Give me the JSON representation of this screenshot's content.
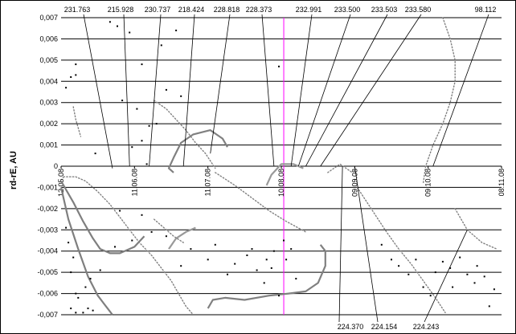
{
  "chart_data": {
    "type": "scatter",
    "title": "",
    "ylabel": "rd-rE, AU",
    "xlabel": "",
    "ylim": [
      -0.007,
      0.007
    ],
    "yticks": [
      "-0,007",
      "-0,006",
      "-0,005",
      "-0,004",
      "-0,003",
      "-0,002",
      "-0,001",
      "0",
      "0,001",
      "0,002",
      "0,003",
      "0,004",
      "0,005",
      "0,006",
      "0,007"
    ],
    "xrange": [
      "12.05.08",
      "08.11.08"
    ],
    "xticks": [
      {
        "date": "12.05.08",
        "label": "12.05.08"
      },
      {
        "date": "11.06.08",
        "label": "11.06.08"
      },
      {
        "date": "11.07.08",
        "label": "11.07.08"
      },
      {
        "date": "10.08.08",
        "label": "10.08.08"
      },
      {
        "date": "09.09.08",
        "label": "09.09.08"
      },
      {
        "date": "09.10.08",
        "label": "09.10.08"
      },
      {
        "date": "08.11.08",
        "label": "08.11.08"
      }
    ],
    "grid": "horizontal",
    "marker_date": "11.08.08",
    "marker_color": "#ff00ff",
    "annotations_top": [
      {
        "label": "231.763",
        "date": "02.06.08",
        "y": -0.0001
      },
      {
        "label": "215.928",
        "date": "09.06.08",
        "y": 0.0
      },
      {
        "label": "230.737",
        "date": "17.06.08",
        "y": 0.0
      },
      {
        "label": "218.424",
        "date": "01.07.08",
        "y": 0.0
      },
      {
        "label": "228.818",
        "date": "12.07.08",
        "y": 0.0006
      },
      {
        "label": "228.373",
        "date": "07.08.08",
        "y": 0.0
      },
      {
        "label": "232.991",
        "date": "14.08.08",
        "y": 0.0
      },
      {
        "label": "233.500",
        "date": "17.08.08",
        "y": 0.0
      },
      {
        "label": "233.503",
        "date": "20.08.08",
        "y": 0.0
      },
      {
        "label": "233.580",
        "date": "26.08.08",
        "y": 0.0
      },
      {
        "label": "98.112",
        "date": "11.10.08",
        "y": 0.0
      }
    ],
    "annotations_bottom": [
      {
        "label": "224.370",
        "date": "04.09.08",
        "y": 0.0
      },
      {
        "label": "224.154",
        "date": "09.09.08",
        "y": 0.0
      },
      {
        "label": "224.243",
        "date": "25.10.08",
        "y": -0.003
      }
    ],
    "series": [
      {
        "style": "curve",
        "color": "#7f7f7f",
        "points": [
          [
            "12.05.08",
            -0.0007
          ],
          [
            "17.05.08",
            -0.0017
          ],
          [
            "21.05.08",
            -0.0026
          ],
          [
            "25.05.08",
            -0.0034
          ],
          [
            "28.05.08",
            -0.0039
          ],
          [
            "01.06.08",
            -0.0041
          ],
          [
            "05.06.08",
            -0.0041
          ],
          [
            "11.06.08",
            -0.0038
          ],
          [
            "15.06.08",
            -0.0033
          ]
        ]
      },
      {
        "style": "curve",
        "color": "#7f7f7f",
        "points": [
          [
            "12.05.08",
            -0.001
          ],
          [
            "15.05.08",
            -0.0025
          ],
          [
            "19.05.08",
            -0.0039
          ],
          [
            "23.05.08",
            -0.0052
          ],
          [
            "27.05.08",
            -0.0061
          ],
          [
            "31.05.08",
            -0.0067
          ],
          [
            "02.06.08",
            -0.007
          ]
        ]
      },
      {
        "style": "curve",
        "color": "#808080",
        "points": [
          [
            "19.07.08",
            0.0009
          ],
          [
            "17.07.08",
            0.0013
          ],
          [
            "12.07.08",
            0.0017
          ],
          [
            "05.07.08",
            0.0015
          ],
          [
            "30.06.08",
            0.0011
          ],
          [
            "27.06.08",
            0.0004
          ],
          [
            "25.06.08",
            -0.0001
          ],
          [
            "27.06.08",
            -0.0003
          ]
        ]
      },
      {
        "style": "curve",
        "color": "#808080",
        "points": [
          [
            "11.07.08",
            -0.0067
          ],
          [
            "13.07.08",
            -0.0063
          ],
          [
            "18.07.08",
            -0.0062
          ],
          [
            "26.07.08",
            -0.0063
          ],
          [
            "05.08.08",
            -0.0061
          ],
          [
            "13.08.08",
            -0.006
          ],
          [
            "20.08.08",
            -0.0059
          ],
          [
            "25.08.08",
            -0.0055
          ],
          [
            "28.08.08",
            -0.0047
          ],
          [
            "28.08.08",
            -0.004
          ],
          [
            "26.08.08",
            -0.0037
          ]
        ]
      },
      {
        "style": "curve",
        "color": "#999999",
        "points": [
          [
            "04.08.08",
            -0.0009
          ],
          [
            "06.08.08",
            -0.0004
          ],
          [
            "10.08.08",
            0.0001
          ],
          [
            "15.08.08",
            0.0001
          ],
          [
            "19.08.08",
            -0.0001
          ]
        ]
      },
      {
        "style": "curve",
        "color": "#999999",
        "points": [
          [
            "25.06.08",
            -0.0039
          ],
          [
            "28.06.08",
            -0.0034
          ],
          [
            "02.07.08",
            -0.0031
          ],
          [
            "06.07.08",
            -0.0029
          ]
        ]
      },
      {
        "style": "dotted",
        "color": "#808080",
        "points": [
          [
            "13.05.08",
            -0.0005
          ],
          [
            "18.05.08",
            -0.0005
          ],
          [
            "22.05.08",
            -0.0007
          ],
          [
            "27.05.08",
            -0.0012
          ],
          [
            "01.06.08",
            -0.0018
          ],
          [
            "05.06.08",
            -0.0024
          ],
          [
            "09.06.08",
            -0.003
          ],
          [
            "13.06.08",
            -0.0036
          ],
          [
            "18.06.08",
            -0.0042
          ],
          [
            "22.06.08",
            -0.0048
          ],
          [
            "26.06.08",
            -0.0054
          ],
          [
            "29.06.08",
            -0.006
          ],
          [
            "02.07.08",
            -0.0066
          ],
          [
            "05.07.08",
            -0.007
          ]
        ]
      },
      {
        "style": "dotted",
        "color": "#808080",
        "points": [
          [
            "19.06.08",
            0.0031
          ],
          [
            "24.06.08",
            0.0027
          ],
          [
            "28.06.08",
            0.0022
          ],
          [
            "02.07.08",
            0.0017
          ],
          [
            "06.07.08",
            0.0011
          ],
          [
            "10.07.08",
            0.0006
          ],
          [
            "14.07.08",
            -0.0001
          ]
        ]
      },
      {
        "style": "dotted",
        "color": "#808080",
        "points": [
          [
            "15.10.08",
            0.007
          ],
          [
            "18.10.08",
            0.006
          ],
          [
            "20.10.08",
            0.005
          ],
          [
            "20.10.08",
            0.004
          ],
          [
            "18.10.08",
            0.003
          ],
          [
            "15.10.08",
            0.002
          ],
          [
            "11.10.08",
            0.001
          ],
          [
            "08.10.08",
            0.0
          ],
          [
            "07.10.08",
            -0.0008
          ]
        ]
      },
      {
        "style": "dotted",
        "color": "#808080",
        "points": [
          [
            "14.07.08",
            -0.0003
          ],
          [
            "22.07.08",
            -0.0009
          ],
          [
            "29.07.08",
            -0.0015
          ],
          [
            "05.08.08",
            -0.0021
          ],
          [
            "12.08.08",
            -0.0026
          ],
          [
            "20.08.08",
            -0.0031
          ]
        ]
      },
      {
        "style": "dotted",
        "color": "#808080",
        "points": [
          [
            "10.09.08",
            -0.001
          ],
          [
            "14.09.08",
            -0.0017
          ],
          [
            "18.09.08",
            -0.0024
          ],
          [
            "22.09.08",
            -0.0031
          ],
          [
            "27.09.08",
            -0.0039
          ],
          [
            "02.10.08",
            -0.0046
          ],
          [
            "07.10.08",
            -0.0054
          ],
          [
            "12.10.08",
            -0.0062
          ],
          [
            "16.10.08",
            -0.0069
          ]
        ]
      },
      {
        "style": "dotted",
        "color": "#808080",
        "points": [
          [
            "20.10.08",
            -0.002
          ],
          [
            "25.10.08",
            -0.003
          ],
          [
            "31.10.08",
            -0.0036
          ],
          [
            "06.11.08",
            -0.0039
          ]
        ]
      },
      {
        "style": "dotted",
        "color": "#808080",
        "points": [
          [
            "29.08.08",
            -0.0003
          ],
          [
            "03.09.08",
            0.0001
          ],
          [
            "08.09.08",
            -0.0003
          ]
        ]
      },
      {
        "style": "dotted",
        "color": "#808080",
        "points": [
          [
            "17.05.08",
            0.0028
          ],
          [
            "18.05.08",
            0.0022
          ],
          [
            "20.05.08",
            0.0014
          ]
        ]
      },
      {
        "style": "dotted",
        "color": "#808080",
        "points": [
          [
            "19.06.08",
            -0.0025
          ],
          [
            "23.06.08",
            -0.0029
          ],
          [
            "27.06.08",
            -0.0033
          ],
          [
            "01.07.08",
            -0.0036
          ]
        ]
      },
      {
        "style": "scatter",
        "color": "#000000",
        "points": [
          [
            "01.06.08",
            0.0068
          ],
          [
            "04.06.08",
            0.0066
          ],
          [
            "09.06.08",
            0.0063
          ],
          [
            "14.06.08",
            0.0048
          ],
          [
            "22.06.08",
            0.0057
          ],
          [
            "28.06.08",
            0.0064
          ],
          [
            "18.05.08",
            0.0048
          ],
          [
            "16.05.08",
            0.0042
          ],
          [
            "14.05.08",
            0.0037
          ],
          [
            "18.05.08",
            0.0043
          ],
          [
            "06.06.08",
            0.0031
          ],
          [
            "12.06.08",
            0.0027
          ],
          [
            "17.06.08",
            0.0019
          ],
          [
            "20.06.08",
            0.002
          ],
          [
            "14.06.08",
            0.0012
          ],
          [
            "10.06.08",
            0.0009
          ],
          [
            "16.06.08",
            0.0001
          ],
          [
            "24.06.08",
            0.0036
          ],
          [
            "30.06.08",
            0.0033
          ],
          [
            "09.08.08",
            0.0047
          ],
          [
            "26.05.08",
            0.0006
          ],
          [
            "14.05.08",
            -0.0029
          ],
          [
            "15.05.08",
            -0.0036
          ],
          [
            "17.05.08",
            -0.0043
          ],
          [
            "16.05.08",
            -0.005
          ],
          [
            "18.05.08",
            -0.006
          ],
          [
            "16.05.08",
            -0.0067
          ],
          [
            "18.05.08",
            -0.0069
          ],
          [
            "19.05.08",
            -0.0062
          ],
          [
            "21.05.08",
            -0.0069
          ],
          [
            "23.05.08",
            -0.0067
          ],
          [
            "25.05.08",
            -0.0068
          ],
          [
            "22.05.08",
            -0.0057
          ],
          [
            "24.05.08",
            -0.0053
          ],
          [
            "28.05.08",
            -0.0049
          ],
          [
            "03.06.08",
            -0.0038
          ],
          [
            "10.06.08",
            -0.0035
          ],
          [
            "18.06.08",
            -0.0031
          ],
          [
            "24.06.08",
            -0.0033
          ],
          [
            "14.06.08",
            -0.0023
          ],
          [
            "05.06.08",
            -0.0021
          ],
          [
            "30.06.08",
            -0.0047
          ],
          [
            "04.07.08",
            -0.0039
          ],
          [
            "11.07.08",
            -0.0044
          ],
          [
            "14.07.08",
            -0.0037
          ],
          [
            "19.07.08",
            -0.0051
          ],
          [
            "22.07.08",
            -0.0046
          ],
          [
            "27.07.08",
            -0.0042
          ],
          [
            "31.07.08",
            -0.0049
          ],
          [
            "03.08.08",
            -0.0055
          ],
          [
            "06.08.08",
            -0.0048
          ],
          [
            "09.08.08",
            -0.0061
          ],
          [
            "12.08.08",
            -0.0044
          ],
          [
            "14.08.08",
            -0.0039
          ],
          [
            "11.08.08",
            -0.0035
          ],
          [
            "16.08.08",
            -0.0053
          ],
          [
            "07.08.08",
            -0.004
          ],
          [
            "04.08.08",
            -0.0044
          ],
          [
            "29.07.08",
            -0.0039
          ],
          [
            "20.09.08",
            -0.0037
          ],
          [
            "24.09.08",
            -0.0044
          ],
          [
            "27.09.08",
            -0.0047
          ],
          [
            "01.10.08",
            -0.0051
          ],
          [
            "04.10.08",
            -0.0044
          ],
          [
            "07.10.08",
            -0.0057
          ],
          [
            "12.10.08",
            -0.005
          ],
          [
            "15.10.08",
            -0.0045
          ],
          [
            "18.10.08",
            -0.0048
          ],
          [
            "22.10.08",
            -0.0043
          ],
          [
            "25.10.08",
            -0.0051
          ],
          [
            "29.10.08",
            -0.0047
          ],
          [
            "01.11.08",
            -0.0052
          ],
          [
            "03.11.08",
            -0.0066
          ],
          [
            "05.11.08",
            -0.0058
          ],
          [
            "10.10.08",
            -0.0061
          ],
          [
            "19.10.08",
            -0.0057
          ],
          [
            "28.10.08",
            -0.0055
          ]
        ]
      }
    ]
  }
}
